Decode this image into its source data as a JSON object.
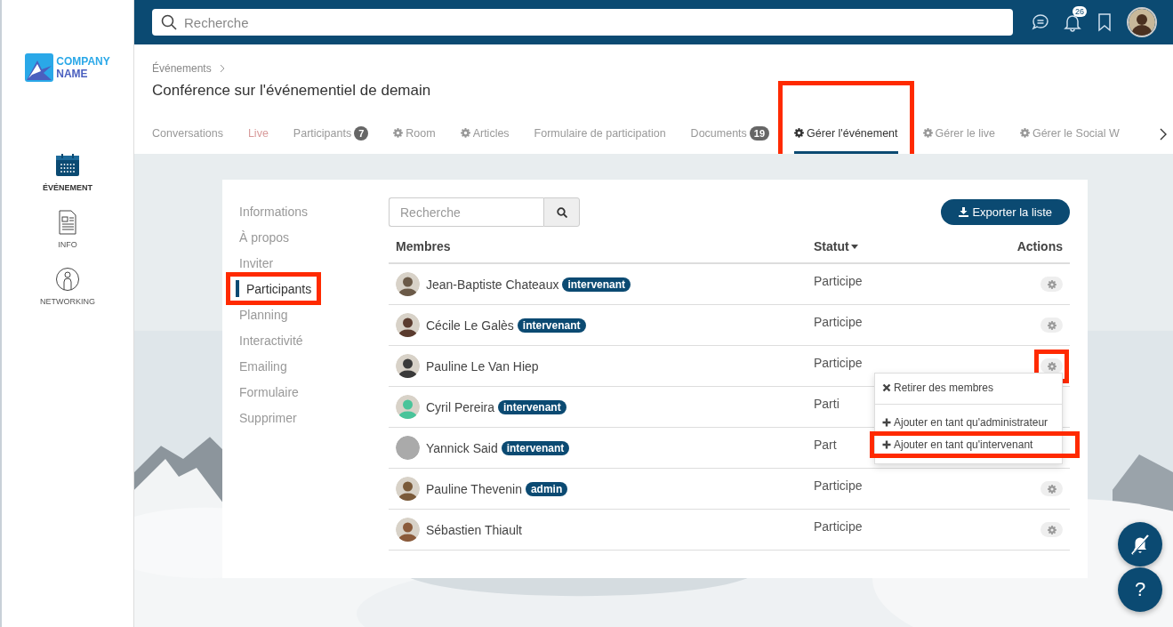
{
  "logo": {
    "lines": [
      "COMPANY",
      "NAME"
    ]
  },
  "app_nav": [
    {
      "label": "ÉVÉNEMENT",
      "selected": true
    },
    {
      "label": "INFO",
      "selected": false
    },
    {
      "label": "NETWORKING",
      "selected": false
    }
  ],
  "topbar": {
    "search": {
      "placeholder": "Recherche"
    },
    "notifications_badge": "26"
  },
  "breadcrumb": [
    "Événements"
  ],
  "title": "Conférence sur l'événementiel de demain",
  "tabs": [
    {
      "label": "Conversations",
      "kind": "plain",
      "selected": false,
      "highlighted": false
    },
    {
      "label": "Live",
      "kind": "live",
      "selected": false,
      "highlighted": false
    },
    {
      "label": "Participants",
      "kind": "plain",
      "badge": "7",
      "selected": false,
      "highlighted": false
    },
    {
      "label": "Room",
      "kind": "gear",
      "selected": false,
      "highlighted": false
    },
    {
      "label": "Articles",
      "kind": "gear",
      "selected": false,
      "highlighted": false
    },
    {
      "label": "Formulaire de participation",
      "kind": "plain",
      "selected": false,
      "highlighted": false
    },
    {
      "label": "Documents",
      "kind": "plain",
      "badge": "19",
      "selected": false,
      "highlighted": false
    },
    {
      "label": "Gérer l'événement",
      "kind": "gear",
      "selected": true,
      "highlighted": true
    },
    {
      "label": "Gérer le live",
      "kind": "gear",
      "selected": false,
      "highlighted": false
    },
    {
      "label": "Gérer le Social W",
      "kind": "gear",
      "selected": false,
      "highlighted": false
    }
  ],
  "manage_nav": [
    {
      "label": "Informations",
      "selected": false,
      "highlighted": false
    },
    {
      "label": "À propos",
      "selected": false,
      "highlighted": false
    },
    {
      "label": "Inviter",
      "selected": false,
      "highlighted": false
    },
    {
      "label": "Participants",
      "selected": true,
      "highlighted": true
    },
    {
      "label": "Planning",
      "selected": false,
      "highlighted": false
    },
    {
      "label": "Interactivité",
      "selected": false,
      "highlighted": false
    },
    {
      "label": "Emailing",
      "selected": false,
      "highlighted": false
    },
    {
      "label": "Formulaire",
      "selected": false,
      "highlighted": false
    },
    {
      "label": "Supprimer",
      "selected": false,
      "highlighted": false
    }
  ],
  "members_search": {
    "placeholder": "Recherche"
  },
  "export_button": "Exporter la liste",
  "table": {
    "columns": [
      {
        "label": "Membres",
        "sortable": false
      },
      {
        "label": "Statut",
        "sortable": true
      },
      {
        "label": "Actions",
        "sortable": false
      }
    ],
    "rows": [
      {
        "name": "Jean-Baptiste Chateaux",
        "tag": "intervenant",
        "status": "Participe",
        "has_photo": true,
        "action_highlighted": false,
        "menu_open": false
      },
      {
        "name": "Cécile Le Galès",
        "tag": "intervenant",
        "status": "Participe",
        "has_photo": true,
        "action_highlighted": false,
        "menu_open": false
      },
      {
        "name": "Pauline Le Van Hiep",
        "status": "Participe",
        "has_photo": true,
        "action_highlighted": true,
        "menu_open": true
      },
      {
        "name": "Cyril Pereira",
        "tag": "intervenant",
        "status": "Parti",
        "has_photo": true,
        "action_highlighted": false,
        "menu_open": false
      },
      {
        "name": "Yannick Said",
        "tag": "intervenant",
        "status": "Part",
        "has_photo": false,
        "action_highlighted": false,
        "menu_open": false
      },
      {
        "name": "Pauline Thevenin",
        "tag": "admin",
        "status": "Participe",
        "has_photo": true,
        "action_highlighted": false,
        "menu_open": false
      },
      {
        "name": "Sébastien Thiault",
        "status": "Participe",
        "has_photo": true,
        "action_highlighted": false,
        "menu_open": false
      }
    ]
  },
  "action_menu": [
    {
      "label": "Retirer des membres",
      "kind": "remove",
      "highlighted": false
    },
    {
      "label": "Ajouter en tant qu'administrateur",
      "kind": "add",
      "highlighted": false
    },
    {
      "label": "Ajouter en tant qu'intervenant",
      "kind": "add",
      "highlighted": true
    }
  ],
  "help_button": "?"
}
